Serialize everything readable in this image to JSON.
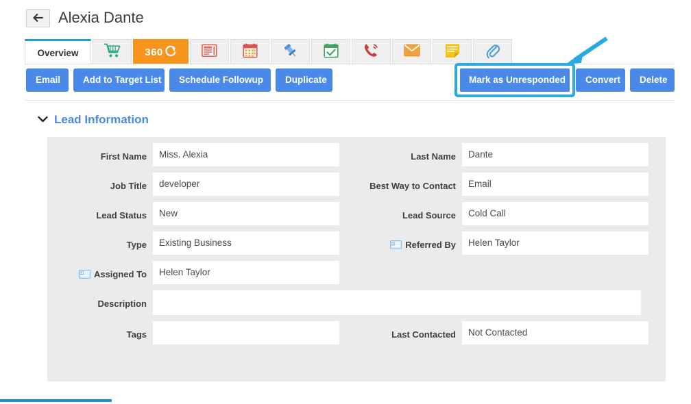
{
  "header": {
    "back_icon": "back-arrow-icon",
    "record_title": "Alexia Dante"
  },
  "tabs": [
    {
      "id": "overview",
      "label": "Overview",
      "icon": null,
      "active": true,
      "type": "text"
    },
    {
      "id": "cart",
      "label": "",
      "icon": "shopping-cart-icon",
      "active": false,
      "type": "icon"
    },
    {
      "id": "three-sixty",
      "label": "360",
      "icon": "360-refresh-icon",
      "active": false,
      "type": "360"
    },
    {
      "id": "invoices",
      "label": "",
      "icon": "invoice-icon",
      "active": false,
      "type": "icon"
    },
    {
      "id": "calendar",
      "label": "",
      "icon": "calendar-icon",
      "active": false,
      "type": "icon"
    },
    {
      "id": "pinned",
      "label": "",
      "icon": "pushpin-icon",
      "active": false,
      "type": "icon"
    },
    {
      "id": "events",
      "label": "",
      "icon": "calendar-check-icon",
      "active": false,
      "type": "icon"
    },
    {
      "id": "calls",
      "label": "",
      "icon": "phone-ringing-icon",
      "active": false,
      "type": "icon"
    },
    {
      "id": "emails",
      "label": "",
      "icon": "envelope-icon",
      "active": false,
      "type": "icon"
    },
    {
      "id": "notes",
      "label": "",
      "icon": "sticky-note-icon",
      "active": false,
      "type": "icon"
    },
    {
      "id": "attachments",
      "label": "",
      "icon": "paperclip-icon",
      "active": false,
      "type": "icon"
    }
  ],
  "actions": {
    "left": [
      {
        "id": "email",
        "label": "Email"
      },
      {
        "id": "add-to-target-list",
        "label": "Add to Target List"
      },
      {
        "id": "schedule-followup",
        "label": "Schedule Followup"
      },
      {
        "id": "duplicate",
        "label": "Duplicate"
      }
    ],
    "right": [
      {
        "id": "mark-as-unresponded",
        "label": "Mark as Unresponded",
        "highlighted": true
      },
      {
        "id": "convert",
        "label": "Convert",
        "highlighted": false
      },
      {
        "id": "delete",
        "label": "Delete",
        "highlighted": false
      }
    ]
  },
  "section": {
    "title": "Lead Information",
    "collapse_icon": "chevron-down-icon",
    "expanded": true
  },
  "fields": {
    "first_name": {
      "label": "First Name",
      "value": "Miss. Alexia",
      "icon": null
    },
    "last_name": {
      "label": "Last Name",
      "value": "Dante",
      "icon": null
    },
    "job_title": {
      "label": "Job Title",
      "value": "developer",
      "icon": null
    },
    "best_way": {
      "label": "Best Way to Contact",
      "value": "Email",
      "icon": null
    },
    "lead_status": {
      "label": "Lead Status",
      "value": "New",
      "icon": null
    },
    "lead_source": {
      "label": "Lead Source",
      "value": "Cold Call",
      "icon": null
    },
    "type": {
      "label": "Type",
      "value": "Existing Business",
      "icon": null
    },
    "referred_by": {
      "label": "Referred By",
      "value": "Helen Taylor",
      "icon": "contact-card-icon"
    },
    "assigned_to": {
      "label": "Assigned To",
      "value": "Helen Taylor",
      "icon": "contact-card-icon"
    },
    "description": {
      "label": "Description",
      "value": "",
      "icon": null
    },
    "tags": {
      "label": "Tags",
      "value": "",
      "icon": null
    },
    "last_contacted": {
      "label": "Last Contacted",
      "value": "Not Contacted",
      "icon": null
    }
  },
  "annotation": {
    "type": "arrow-pointing-to-mark-as-unresponded",
    "color": "#29abe2",
    "target": "mark-as-unresponded"
  },
  "colors": {
    "primary_button": "#4a89e8",
    "accent_tab": "#1e9ae0",
    "tab360": "#f7941e",
    "panel_bg": "#ebebeb",
    "highlight": "#29abe2",
    "section_title": "#4a89e8"
  }
}
